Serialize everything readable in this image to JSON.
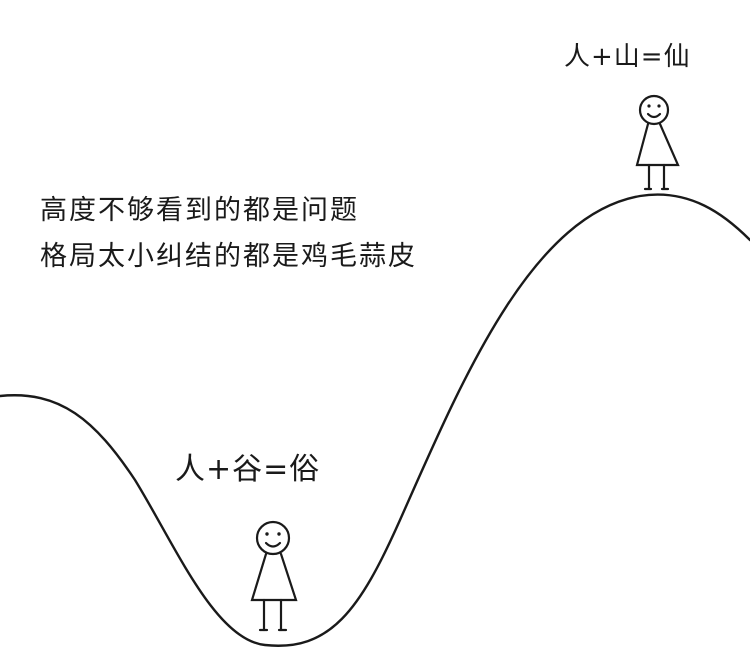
{
  "equation_top": "人+山=仙",
  "equation_bottom": "人+谷=俗",
  "quote": {
    "line1": "高度不够看到的都是问题",
    "line2": "格局太小纠结的都是鸡毛蒜皮"
  },
  "colors": {
    "ink": "#1a1a1a",
    "background": "#ffffff"
  }
}
